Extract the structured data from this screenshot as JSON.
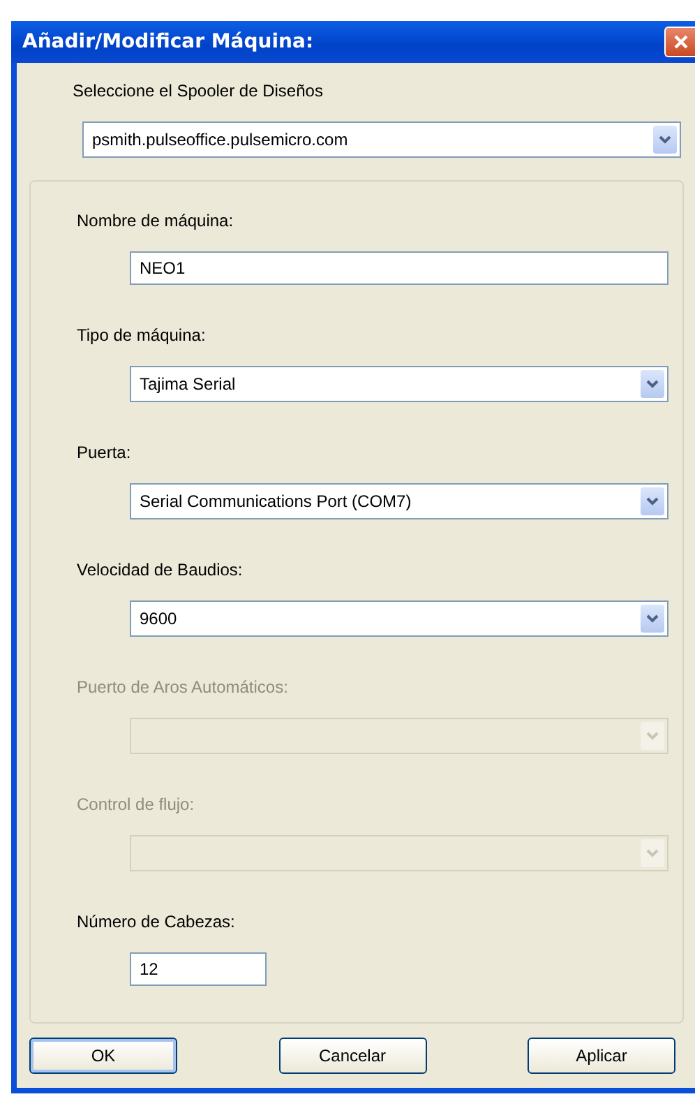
{
  "window": {
    "title": "Añadir/Modificar Máquina:"
  },
  "spooler": {
    "label": "Seleccione el Spooler de Diseños",
    "value": "psmith.pulseoffice.pulsemicro.com"
  },
  "fields": [
    {
      "kind": "text",
      "label": "Nombre de máquina:",
      "value": "NEO1",
      "disabled": false
    },
    {
      "kind": "combo",
      "label": "Tipo de máquina:",
      "value": "Tajima Serial",
      "disabled": false
    },
    {
      "kind": "combo",
      "label": "Puerta:",
      "value": "Serial Communications Port (COM7)",
      "disabled": false
    },
    {
      "kind": "combo",
      "label": "Velocidad de Baudios:",
      "value": "9600",
      "disabled": false
    },
    {
      "kind": "combo",
      "label": "Puerto de Aros Automáticos:",
      "disabled": true
    },
    {
      "kind": "combo",
      "label": "Control de flujo:",
      "disabled": true
    },
    {
      "kind": "number",
      "label": "Número de Cabezas:",
      "value": "12",
      "disabled": false
    }
  ],
  "buttons": [
    "OK",
    "Cancelar",
    "Aplicar"
  ]
}
